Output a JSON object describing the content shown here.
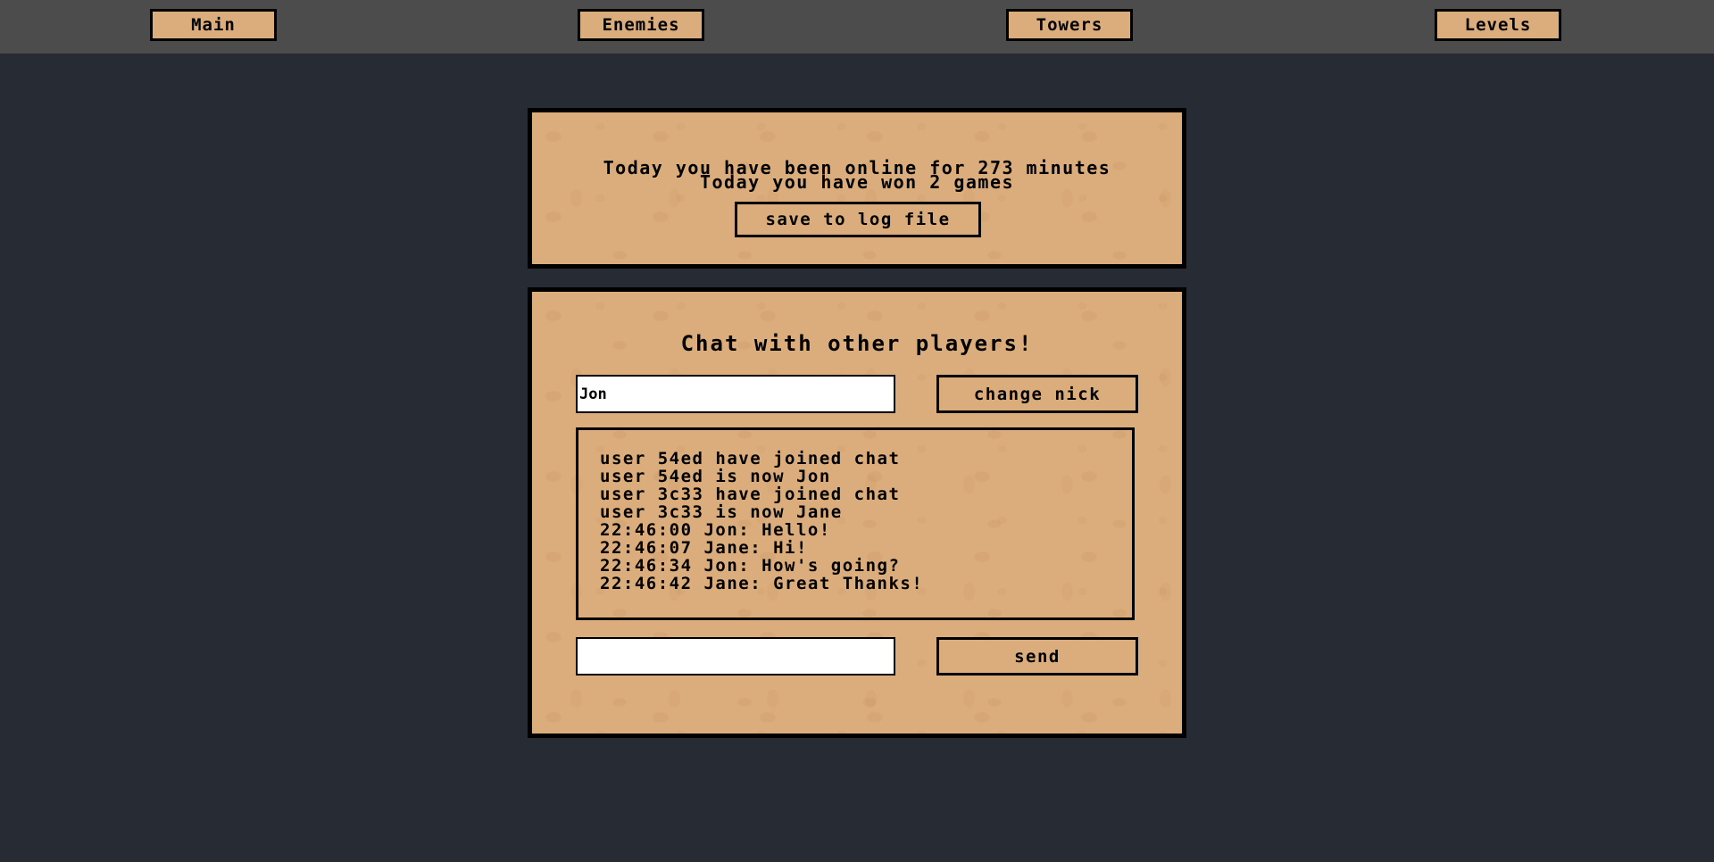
{
  "nav": {
    "main_label": "Main",
    "enemies_label": "Enemies",
    "towers_label": "Towers",
    "levels_label": "Levels"
  },
  "stats": {
    "online_text": "Today you have been online for 273 minutes",
    "won_text": "Today you have won 2 games",
    "save_label": "save to log file"
  },
  "chat": {
    "title": "Chat with other players!",
    "nick_value": "Jon",
    "change_nick_label": "change nick",
    "messages": [
      "user 54ed have joined chat",
      "user 54ed is now Jon",
      "user 3c33 have joined chat",
      "user 3c33 is now Jane",
      "22:46:00 Jon: Hello!",
      "22:46:07 Jane: Hi!",
      "22:46:34 Jon: How's going?",
      "22:46:42 Jane: Great Thanks!"
    ],
    "message_value": "",
    "send_label": "send"
  },
  "colors": {
    "page_background": "#272b34",
    "top_bar": "#4c4c4c",
    "panel_sand": "#dcad7c",
    "border": "#000000"
  }
}
